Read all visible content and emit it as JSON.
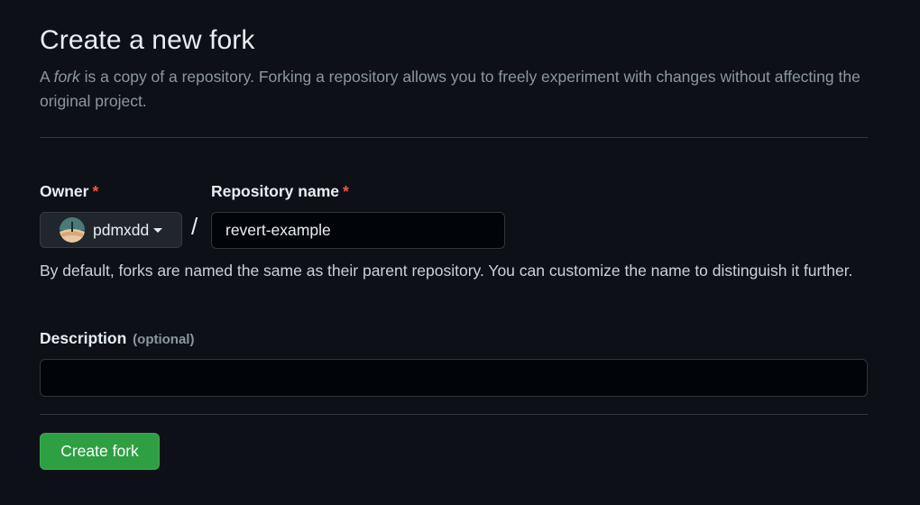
{
  "page": {
    "title": "Create a new fork",
    "intro_prefix": "A ",
    "intro_emphasis": "fork",
    "intro_suffix": " is a copy of a repository. Forking a repository allows you to freely experiment with changes without affecting the original project."
  },
  "owner": {
    "label": "Owner",
    "required_mark": "*",
    "selected": "pdmxdd",
    "avatar_icon": "user-avatar"
  },
  "separator": "/",
  "repository": {
    "label": "Repository name",
    "required_mark": "*",
    "value": "revert-example",
    "hint": "By default, forks are named the same as their parent repository. You can customize the name to distinguish it further."
  },
  "description": {
    "label": "Description",
    "optional_note": "(optional)",
    "value": ""
  },
  "actions": {
    "create_label": "Create fork"
  },
  "colors": {
    "background": "#0d1117",
    "primary_button": "#2ea043",
    "required": "#f85149",
    "muted_text": "#8d96a0"
  }
}
